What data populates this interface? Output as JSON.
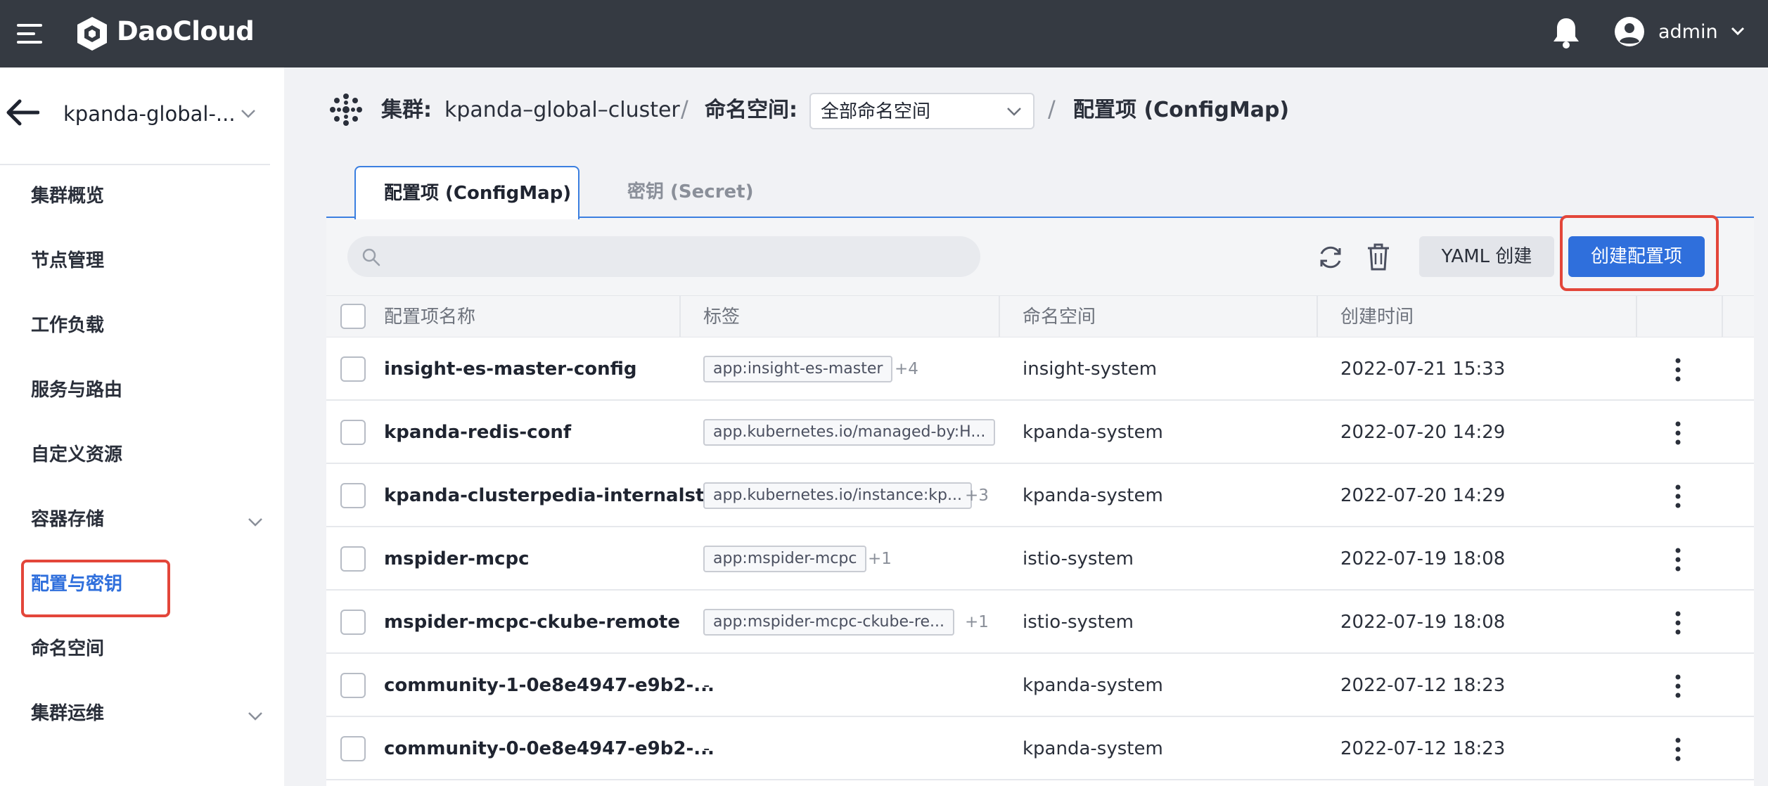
{
  "topbar": {
    "brand": "DaoCloud",
    "user_name": "admin",
    "icons": [
      "menu-icon",
      "daocloud-logo",
      "bell-icon",
      "user-avatar-icon",
      "chevron-down-icon"
    ]
  },
  "sidebar": {
    "cluster_name": "kpanda-global-...",
    "items": [
      {
        "label": "集群概览",
        "has_chevron": false,
        "active": false
      },
      {
        "label": "节点管理",
        "has_chevron": false,
        "active": false
      },
      {
        "label": "工作负载",
        "has_chevron": false,
        "active": false
      },
      {
        "label": "服务与路由",
        "has_chevron": false,
        "active": false
      },
      {
        "label": "自定义资源",
        "has_chevron": false,
        "active": false
      },
      {
        "label": "容器存储",
        "has_chevron": true,
        "active": false
      },
      {
        "label": "配置与密钥",
        "has_chevron": false,
        "active": true
      },
      {
        "label": "命名空间",
        "has_chevron": false,
        "active": false
      },
      {
        "label": "集群运维",
        "has_chevron": true,
        "active": false
      }
    ]
  },
  "breadcrumb": {
    "cluster_label": "集群:",
    "cluster_value": "kpanda–global–cluster",
    "separator": "/",
    "namespace_label": "命名空间:",
    "namespace_select": "全部命名空间",
    "current": "配置项 (ConfigMap)"
  },
  "tabs": [
    {
      "label": "配置项 (ConfigMap)",
      "active": true
    },
    {
      "label": "密钥 (Secret)",
      "active": false
    }
  ],
  "toolbar": {
    "search_placeholder": "",
    "yaml_create": "YAML 创建",
    "create_button": "创建配置项"
  },
  "table": {
    "columns": [
      "配置项名称",
      "标签",
      "命名空间",
      "创建时间"
    ],
    "rows": [
      {
        "name": "insight-es-master-config",
        "tag": "app:insight-es-master",
        "more": "+4",
        "namespace": "insight-system",
        "created": "2022-07-21 15:33"
      },
      {
        "name": "kpanda-redis-conf",
        "tag": "app.kubernetes.io/managed-by:H...",
        "more": "",
        "namespace": "kpanda-system",
        "created": "2022-07-20 14:29"
      },
      {
        "name": "kpanda-clusterpedia-internalst...",
        "tag": "app.kubernetes.io/instance:kp...",
        "more": "+3",
        "namespace": "kpanda-system",
        "created": "2022-07-20 14:29"
      },
      {
        "name": "mspider-mcpc",
        "tag": "app:mspider-mcpc",
        "more": "+1",
        "namespace": "istio-system",
        "created": "2022-07-19 18:08"
      },
      {
        "name": "mspider-mcpc-ckube-remote",
        "tag": "app:mspider-mcpc-ckube-re...",
        "more": "+1",
        "namespace": "istio-system",
        "created": "2022-07-19 18:08"
      },
      {
        "name": "community-1-0e8e4947-e9b2-...",
        "tag": "",
        "dash": "-",
        "more": "",
        "namespace": "kpanda-system",
        "created": "2022-07-12 18:23"
      },
      {
        "name": "community-0-0e8e4947-e9b2-...",
        "tag": "",
        "dash": "-",
        "more": "",
        "namespace": "kpanda-system",
        "created": "2022-07-12 18:23"
      }
    ]
  },
  "colors": {
    "topbar": "#353a42",
    "accent": "#2f6fdc",
    "highlight": "#e3463a"
  }
}
